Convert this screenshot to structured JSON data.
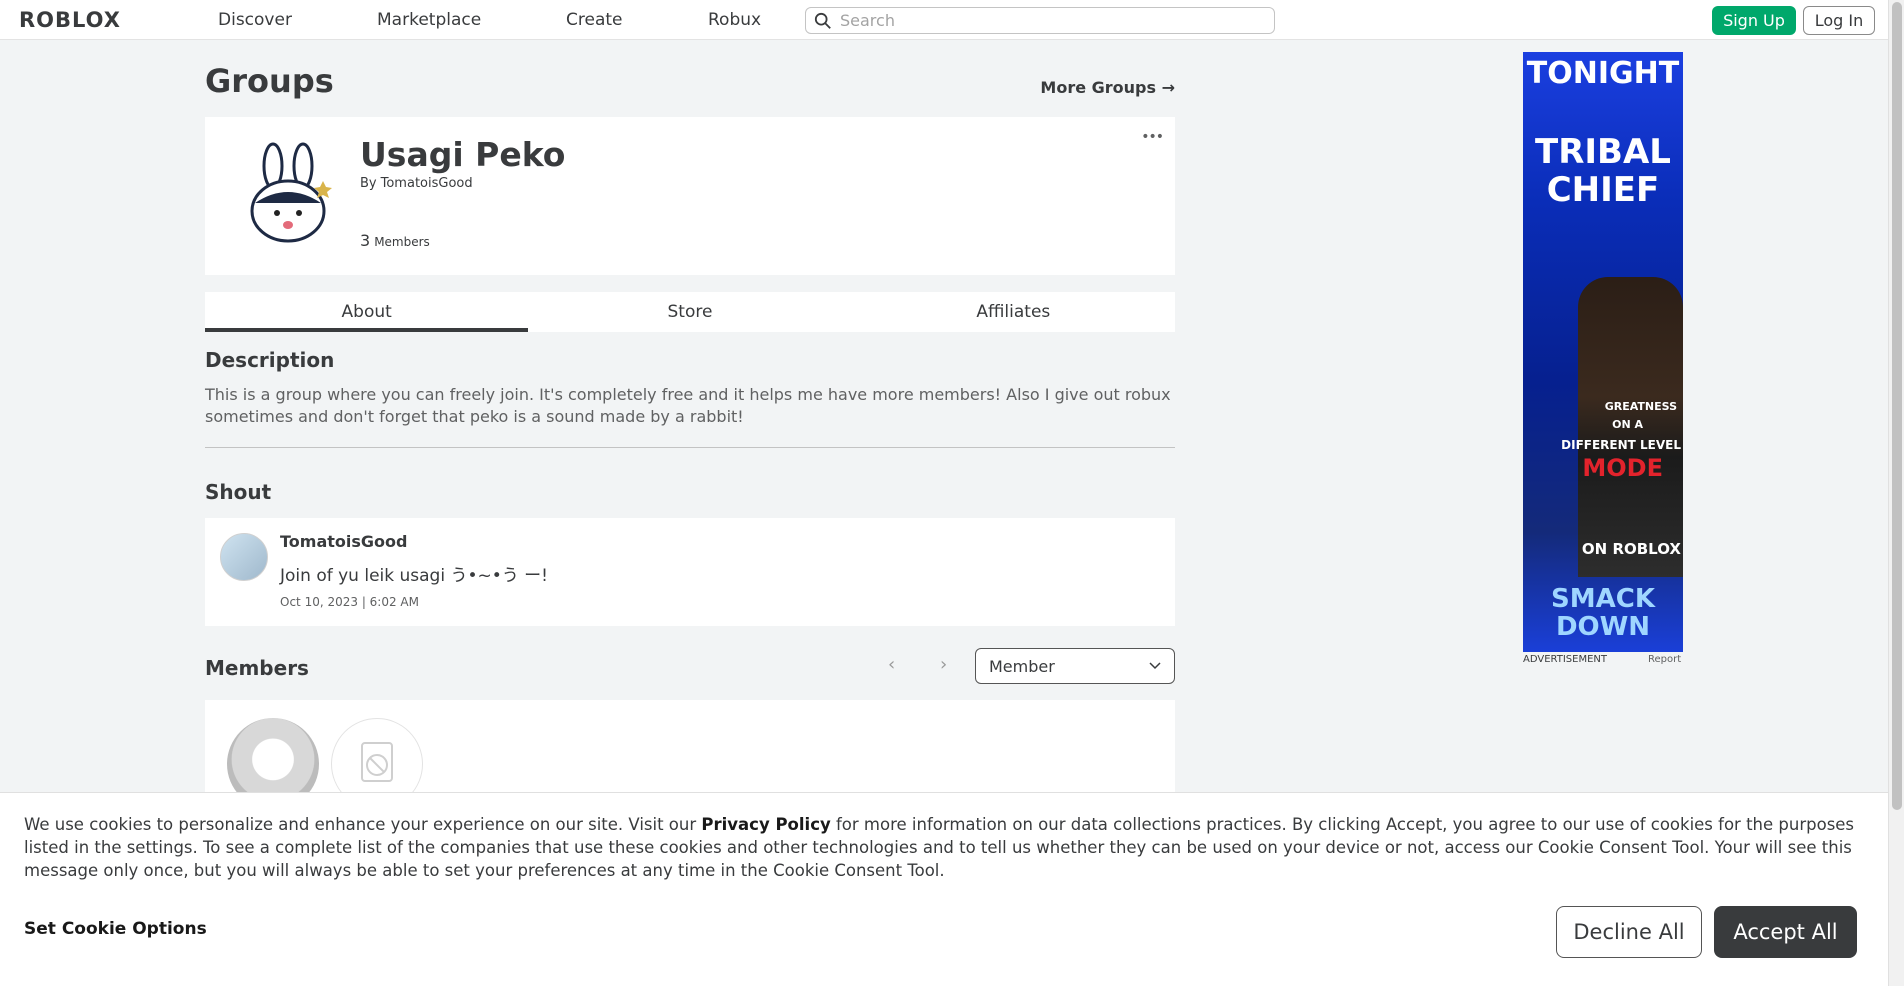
{
  "header": {
    "logo": "ROBLOX",
    "nav": [
      "Discover",
      "Marketplace",
      "Create",
      "Robux"
    ],
    "search_placeholder": "Search",
    "signup_label": "Sign Up",
    "login_label": "Log In"
  },
  "page": {
    "title": "Groups",
    "more_groups": "More Groups →"
  },
  "group": {
    "name": "Usagi Peko",
    "by_label": "By",
    "owner": "TomatoisGood",
    "member_count": "3",
    "members_label": "Members",
    "more_menu": "•••"
  },
  "tabs": [
    "About",
    "Store",
    "Affiliates"
  ],
  "about": {
    "description_title": "Description",
    "description_text": "This is a group where you can freely join. It's completely free and it helps me have more members! Also I give out robux sometimes and don't forget that peko is a sound made by a rabbit!",
    "shout_title": "Shout",
    "shout": {
      "author": "TomatoisGood",
      "text": "Join of yu leik usagi う•~•う ー!",
      "date": "Oct 10, 2023 | 6:02 AM"
    },
    "members_title": "Members",
    "role_select": "Member",
    "pager_prev": "‹",
    "pager_next": "›"
  },
  "ad": {
    "line1": "TONIGHT",
    "line2": "TRIBAL",
    "line3": "CHIEF",
    "line4": "GREATNESS",
    "line5": "ON A",
    "line6": "DIFFERENT LEVEL",
    "line7": "MODE",
    "line8": "ON ROBLOX",
    "line9": "SMACK",
    "line10": "DOWN",
    "label": "ADVERTISEMENT",
    "report": "Report"
  },
  "cookie": {
    "text_before": "We use cookies to personalize and enhance your experience on our site. Visit our ",
    "privacy_link": "Privacy Policy",
    "text_after": " for more information on our data collections practices. By clicking Accept, you agree to our use of cookies for the purposes listed in the settings. To see a complete list of the companies that use these cookies and other technologies and to tell us whether they can be used on your device or not, access our Cookie Consent Tool. Your will see this message only once, but you will always be able to set your preferences at any time in the Cookie Consent Tool.",
    "options_label": "Set Cookie Options",
    "decline_label": "Decline All",
    "accept_label": "Accept All"
  },
  "colors": {
    "signup_green": "#00a86b",
    "text_dark": "#393b3d",
    "background": "#f2f4f5"
  }
}
